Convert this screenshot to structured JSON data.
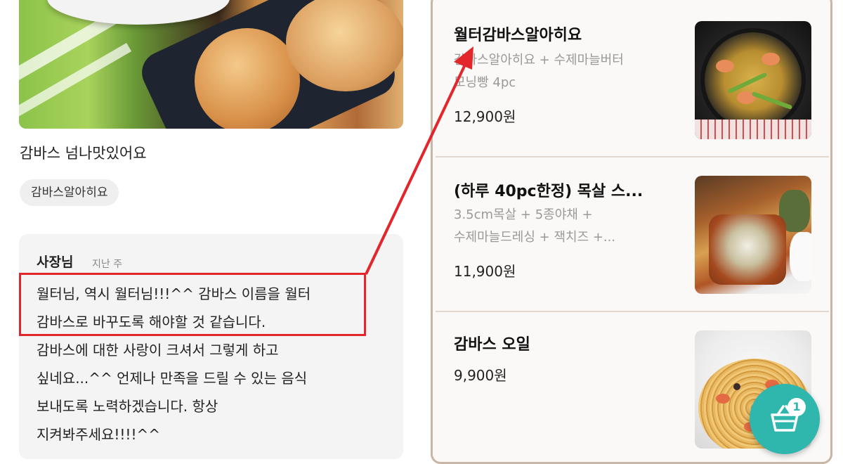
{
  "review": {
    "text": "감바스 넘나맛있어요",
    "tag": "감바스알아히요"
  },
  "reply": {
    "author": "사장님",
    "time": "지난 주",
    "lines": [
      "월터님, 역시 월터님!!!^^ 감바스 이름을 월터",
      "감바스로 바꾸도록 해야할 것 같습니다.",
      "감바스에 대한 사랑이 크셔서 그렇게 하고",
      "싶네요...^^ 언제나 만족을 드릴 수 있는 음식",
      "보내도록 노력하겠습니다. 항상",
      "지켜봐주세요!!!!^^"
    ]
  },
  "menu": [
    {
      "title": "월터감바스알아히요",
      "desc": [
        "감바스알아히요 + 수제마늘버터",
        "모닝빵 4pc"
      ],
      "price": "12,900원",
      "image": "garlic-shrimp-skillet"
    },
    {
      "title": "(하루 40pc한정) 목살 스...",
      "desc": [
        "3.5cm목살 + 5종야채 +",
        "수제마늘드레싱 + 잭치즈 +..."
      ],
      "price": "11,900원",
      "image": "pork-neck-steak-plate"
    },
    {
      "title": "감바스 오일",
      "desc": [],
      "price": "9,900원",
      "image": "shrimp-oil-pasta"
    }
  ],
  "cart": {
    "icon": "basket-icon",
    "count": "1",
    "color": "#2fb7ad"
  },
  "annotation": {
    "color": "#e3262b"
  }
}
